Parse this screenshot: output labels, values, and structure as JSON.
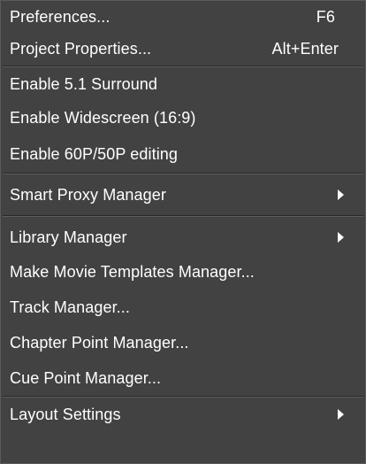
{
  "menu": {
    "preferences": {
      "label": "Preferences...",
      "shortcut": "F6"
    },
    "project_properties": {
      "label": "Project Properties...",
      "shortcut": "Alt+Enter"
    },
    "enable_surround": {
      "label": "Enable 5.1 Surround"
    },
    "enable_widescreen": {
      "label": "Enable Widescreen (16:9)"
    },
    "enable_60p": {
      "label": "Enable 60P/50P editing"
    },
    "smart_proxy_manager": {
      "label": "Smart Proxy Manager"
    },
    "library_manager": {
      "label": "Library Manager"
    },
    "make_movie_templates": {
      "label": "Make Movie Templates Manager..."
    },
    "track_manager": {
      "label": "Track Manager..."
    },
    "chapter_point_manager": {
      "label": "Chapter Point Manager..."
    },
    "cue_point_manager": {
      "label": "Cue Point Manager..."
    },
    "layout_settings": {
      "label": "Layout Settings"
    }
  },
  "icons": {
    "submenu_arrow": "submenu-arrow-icon"
  },
  "colors": {
    "background": "#424242",
    "text": "#ffffff",
    "divider_dark": "#2a2a2a",
    "divider_light": "#5e5e5e"
  }
}
